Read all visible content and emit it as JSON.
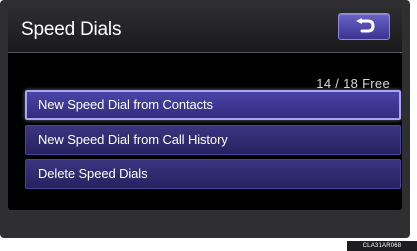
{
  "header": {
    "title": "Speed Dials",
    "back_icon": "return-arrow-icon"
  },
  "free_count": "14 / 18 Free",
  "menu": {
    "items": [
      {
        "label": "New Speed Dial from Contacts",
        "selected": true
      },
      {
        "label": "New Speed Dial from Call History",
        "selected": false
      },
      {
        "label": "Delete Speed Dials",
        "selected": false
      }
    ]
  },
  "image_code": "CLA31AR068",
  "colors": {
    "button_blue": "#4a44a6",
    "highlight_border": "#a9a6ee",
    "background": "#000000"
  }
}
